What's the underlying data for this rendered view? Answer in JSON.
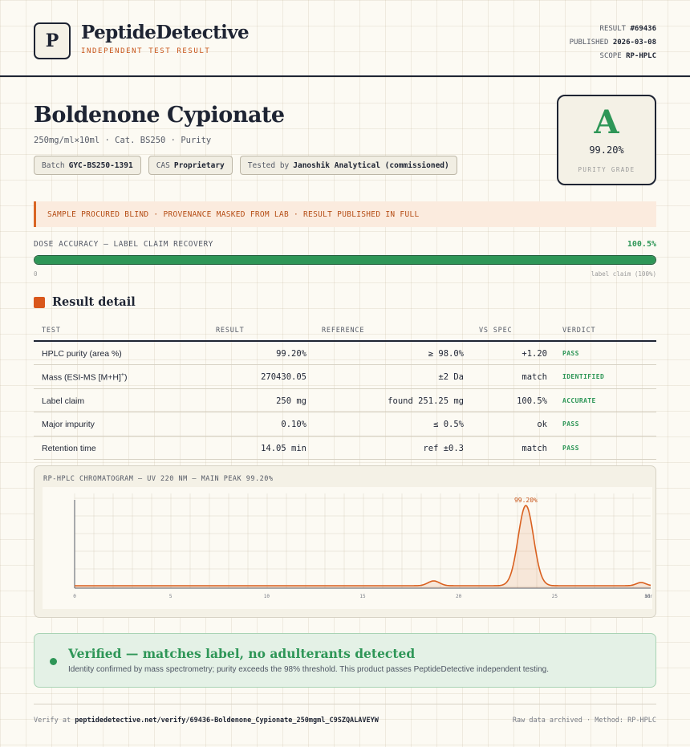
{
  "header": {
    "logo_letter": "P",
    "brand": "PeptideDetective",
    "brand_sub": "INDEPENDENT TEST RESULT",
    "result_label": "RESULT",
    "result_value": "#69436",
    "published_label": "PUBLISHED",
    "published_value": "2026-03-08",
    "scope_label": "SCOPE",
    "scope_value": "RP-HPLC"
  },
  "product": {
    "title": "Boldenone Cypionate",
    "subtitle": "250mg/ml×10ml · Cat. BS250 · Purity",
    "chips": [
      {
        "label": "Batch",
        "value": "GYC-BS250-1391"
      },
      {
        "label": "CAS",
        "value": "Proprietary"
      },
      {
        "label": "Tested by",
        "value": "Janoshik Analytical (commissioned)"
      }
    ]
  },
  "grade": {
    "letter": "A",
    "value": "99.20%",
    "label": "PURITY GRADE"
  },
  "banner": "SAMPLE PROCURED BLIND · PROVENANCE MASKED FROM LAB · RESULT PUBLISHED IN FULL",
  "dose": {
    "label": "DOSE ACCURACY — LABEL CLAIM RECOVERY",
    "value": "100.5%",
    "fraction": 1.0,
    "min_label": "0",
    "max_label": "label claim (100%)"
  },
  "section_title": "Result detail",
  "table": {
    "headers": [
      "TEST",
      "RESULT",
      "REFERENCE",
      "VS SPEC",
      "VERDICT"
    ],
    "rows": [
      {
        "test": "HPLC purity (area %)",
        "result": "99.20%",
        "reference": "≥ 98.0%",
        "vs": "+1.20",
        "verdict": "PASS"
      },
      {
        "test": "Mass (ESI-MS [M+H]",
        "test_sup": "+",
        "test_end": ")",
        "result": "270430.05",
        "reference": "±2 Da",
        "vs": "match",
        "verdict": "IDENTIFIED"
      },
      {
        "test": "Label claim",
        "result": "250 mg",
        "reference": "found 251.25 mg",
        "vs": "100.5%",
        "verdict": "ACCURATE"
      },
      {
        "test": "Major impurity",
        "result": "0.10%",
        "reference": "≤ 0.5%",
        "vs": "ok",
        "verdict": "PASS"
      },
      {
        "test": "Retention time",
        "result": "14.05 min",
        "reference": "ref ±0.3",
        "vs": "match",
        "verdict": "PASS"
      }
    ]
  },
  "chromatogram": {
    "label": "RP-HPLC CHROMATOGRAM — UV 220 NM — MAIN PEAK 99.20%",
    "peak_label": "99.20%",
    "x_ticks": [
      "0",
      "5",
      "10",
      "15",
      "20",
      "25",
      "30"
    ],
    "x_unit": "min",
    "x_range": [
      0,
      30
    ],
    "peaks": [
      {
        "center": 18.7,
        "height": 0.06,
        "width": 0.3
      },
      {
        "center": 23.5,
        "height": 1.0,
        "width": 0.4
      },
      {
        "center": 29.5,
        "height": 0.04,
        "width": 0.25
      }
    ],
    "baseline": 0.01,
    "color": "#d9601f"
  },
  "verified": {
    "title": "Verified — matches label, no adulterants detected",
    "text": "Identity confirmed by mass spectrometry; purity exceeds the 98% threshold. This product passes PeptideDetective independent testing."
  },
  "footer": {
    "verify_prefix": "Verify at",
    "verify_url": "peptidedetective.net/verify/69436-Boldenone_Cypionate_250mgml_C9SZQALAVEYW",
    "right": "Raw data archived · Method: RP-HPLC"
  },
  "colors": {
    "accent": "#d9571c",
    "pass": "#2e9657",
    "ink": "#1e2433"
  }
}
